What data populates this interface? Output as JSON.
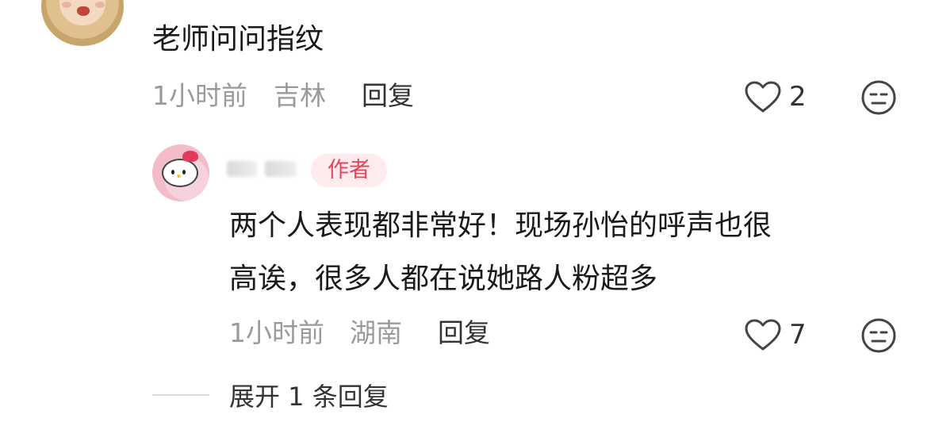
{
  "comment": {
    "text": "老师问问指纹",
    "time": "1小时前",
    "location": "吉林",
    "reply_label": "回复",
    "likes": "2"
  },
  "reply": {
    "author_badge": "作者",
    "text_line1": "两个人表现都非常好！现场孙怡的呼声也很",
    "text_line2": "高诶，很多人都在说她路人粉超多",
    "time": "1小时前",
    "location": "湖南",
    "reply_label": "回复",
    "likes": "7"
  },
  "expand": {
    "label": "展开 1 条回复"
  },
  "colors": {
    "badge_text": "#e8435a",
    "badge_bg": "#fdebed",
    "meta_text": "#9a9a9a"
  },
  "icons": {
    "like": "heart-outline-icon",
    "dislike": "dislike-face-icon"
  }
}
